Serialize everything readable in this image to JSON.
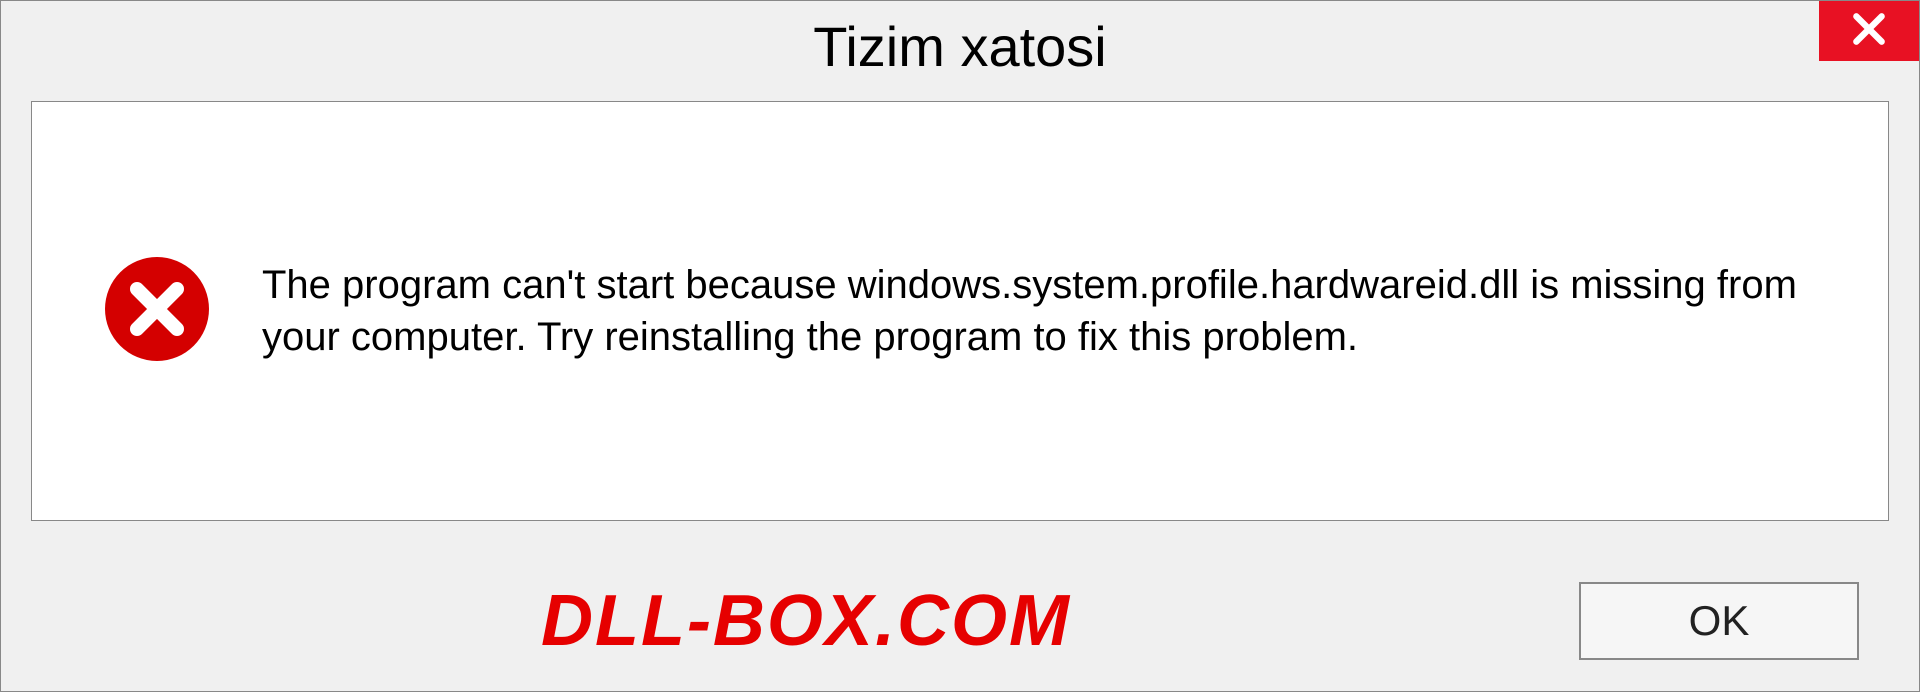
{
  "dialog": {
    "title": "Tizim xatosi",
    "message": "The program can't start because windows.system.profile.hardwareid.dll is missing from your computer. Try reinstalling the program to fix this problem.",
    "ok_label": "OK"
  },
  "watermark": "DLL-BOX.COM",
  "colors": {
    "close_bg": "#e81123",
    "error_icon": "#d40000",
    "watermark": "#e60000"
  }
}
